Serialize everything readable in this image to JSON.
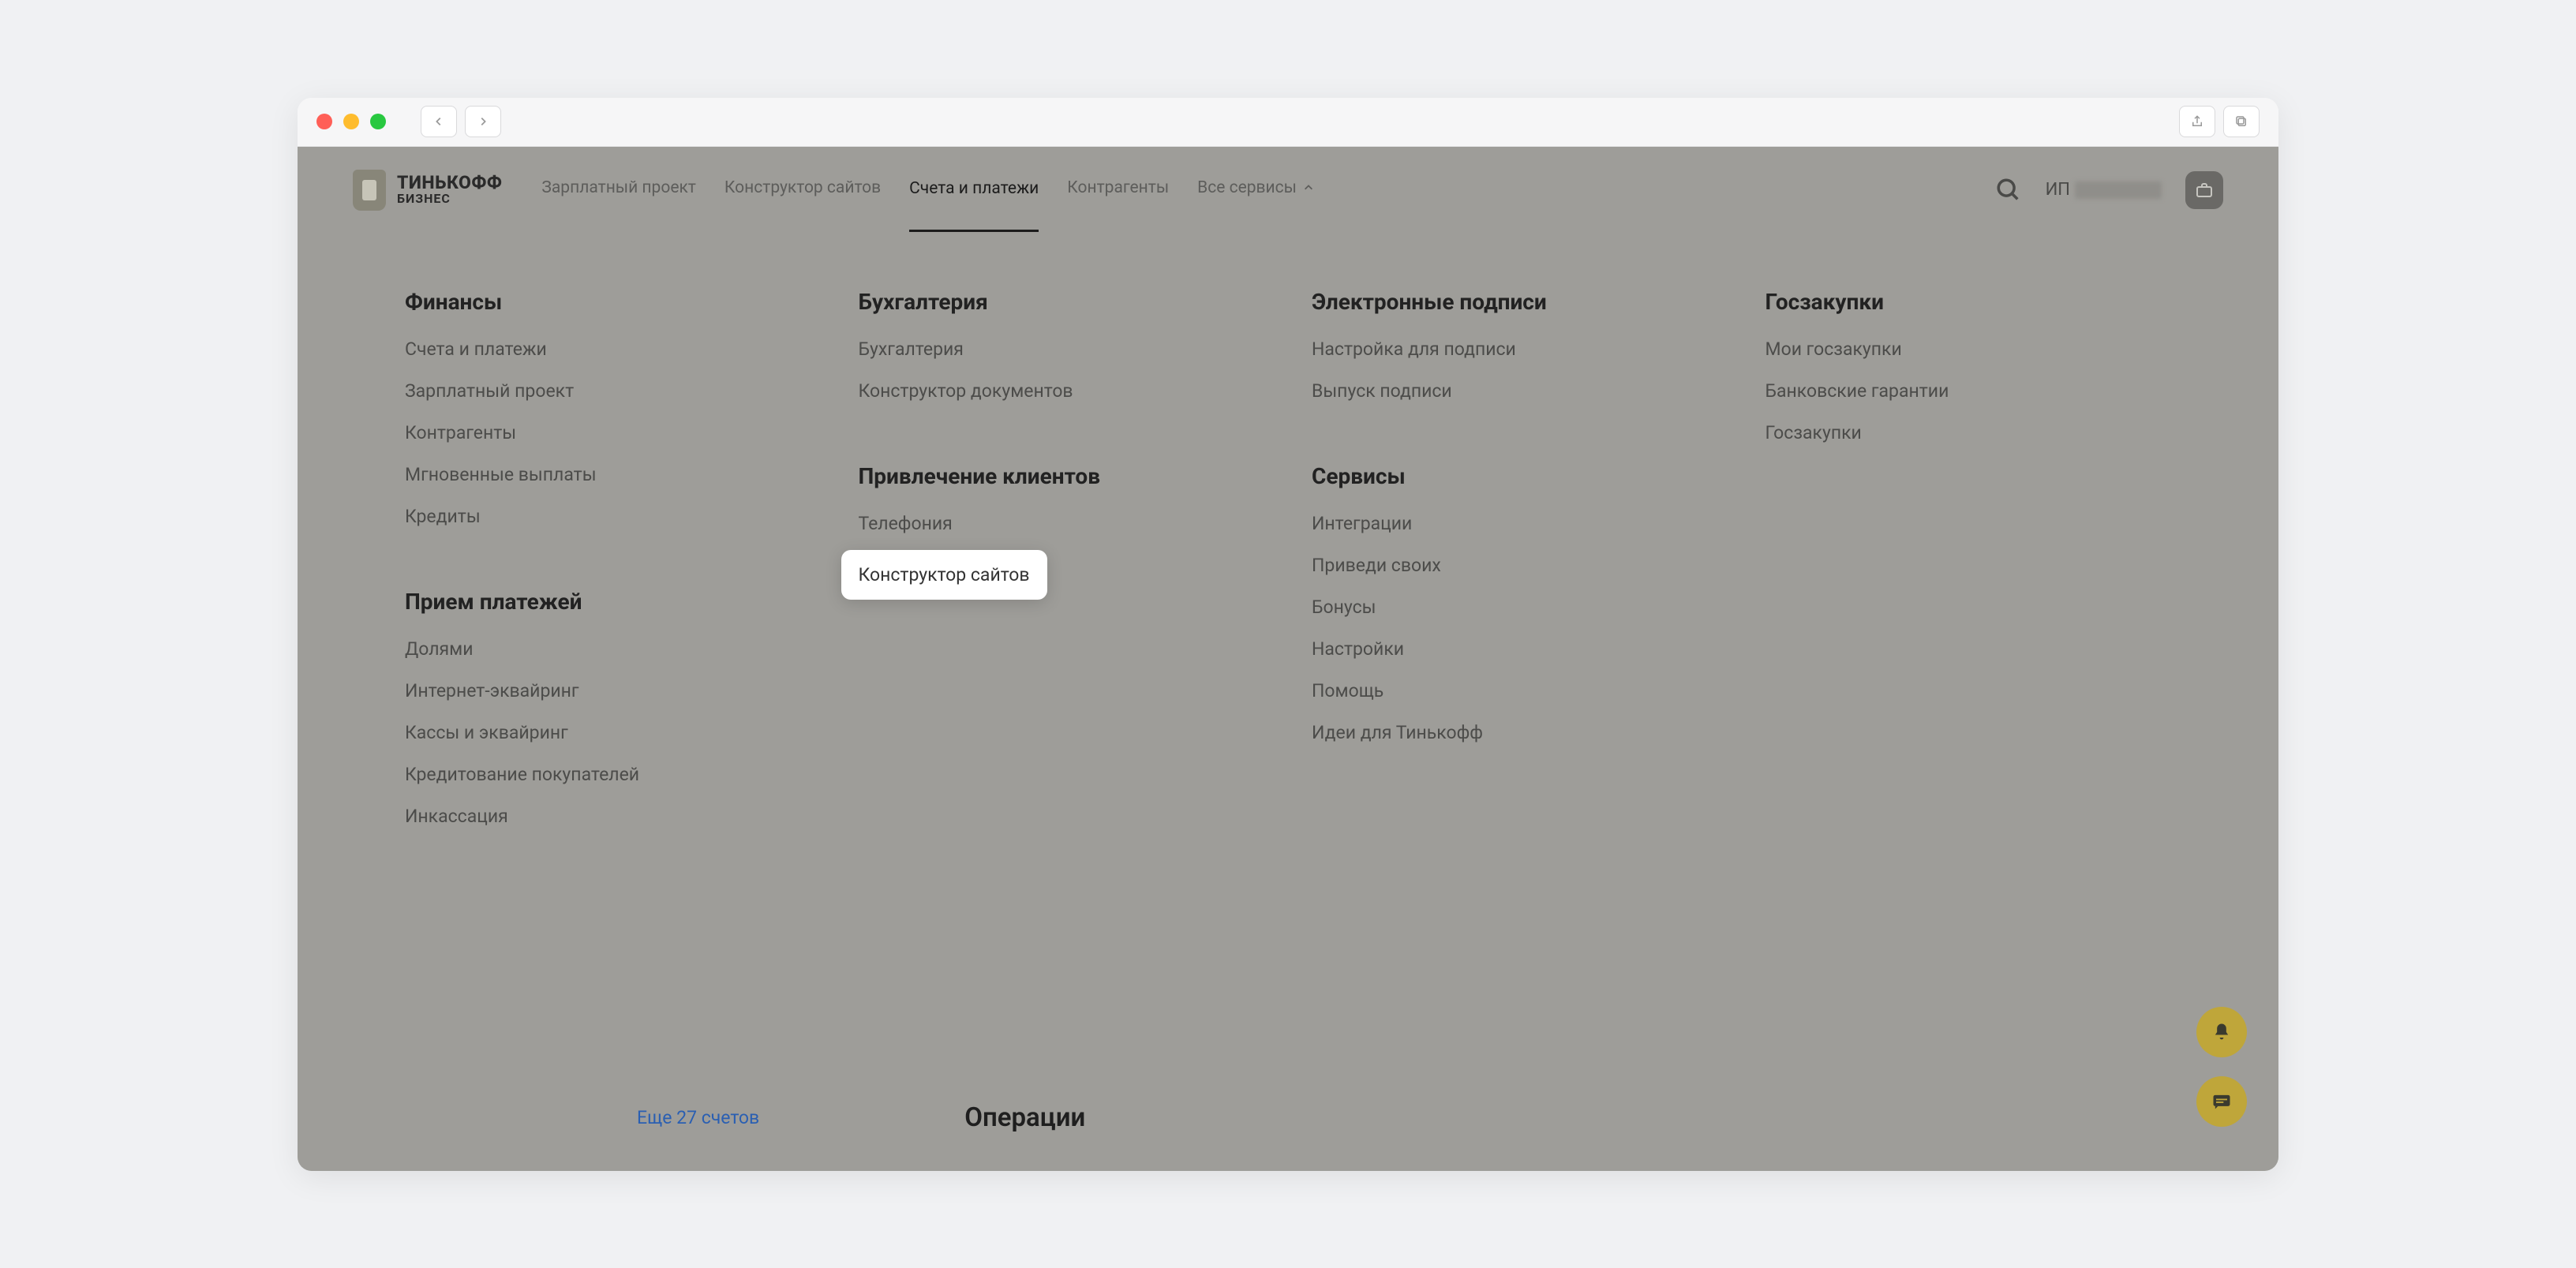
{
  "logo": {
    "line1": "ТИНЬКОФФ",
    "line2": "БИЗНЕС"
  },
  "topnav": {
    "items": [
      "Зарплатный проект",
      "Конструктор сайтов",
      "Счета и платежи",
      "Контрагенты"
    ],
    "more_label": "Все сервисы"
  },
  "user_prefix": "ИП",
  "mega": {
    "col1": {
      "h1": "Финансы",
      "links1": [
        "Счета и платежи",
        "Зарплатный проект",
        "Контрагенты",
        "Мгновенные выплаты",
        "Кредиты"
      ],
      "h2": "Прием платежей",
      "links2": [
        "Долями",
        "Интернет-эквайринг",
        "Кассы и эквайринг",
        "Кредитование покупателей",
        "Инкассация"
      ]
    },
    "col2": {
      "h1": "Бухгалтерия",
      "links1": [
        "Бухгалтерия",
        "Конструктор документов"
      ],
      "h2": "Привлечение клиентов",
      "links2": [
        "Телефония",
        "Конструктор сайтов"
      ]
    },
    "col3": {
      "h1": "Электронные подписи",
      "links1": [
        "Настройка для подписи",
        "Выпуск подписи"
      ],
      "h2": "Сервисы",
      "links2": [
        "Интеграции",
        "Приведи своих",
        "Бонусы",
        "Настройки",
        "Помощь",
        "Идеи для Тинькофф"
      ]
    },
    "col4": {
      "h1": "Госзакупки",
      "links1": [
        "Мои госзакупки",
        "Банковские гарантии",
        "Госзакупки"
      ]
    }
  },
  "bg": {
    "more_accounts": "Еще 27 счетов",
    "operations": "Операции"
  }
}
